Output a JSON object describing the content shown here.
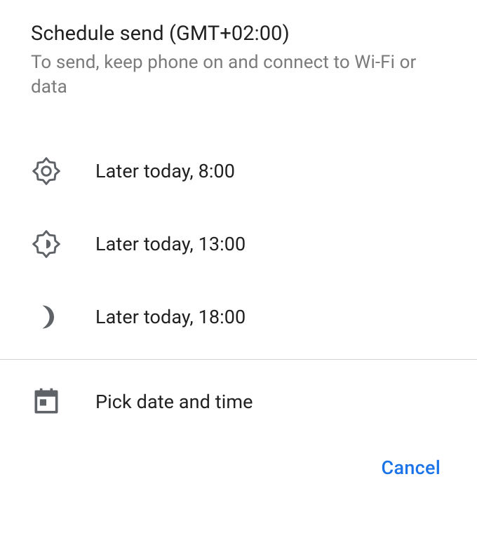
{
  "header": {
    "title": "Schedule send (GMT+02:00)",
    "subtitle": "To send, keep phone on and connect to Wi-Fi or data"
  },
  "options": [
    {
      "icon": "brightness-high-icon",
      "label": "Later today, 8:00"
    },
    {
      "icon": "brightness-medium-icon",
      "label": "Later today, 13:00"
    },
    {
      "icon": "night-icon",
      "label": "Later today, 18:00"
    }
  ],
  "custom_option": {
    "icon": "calendar-icon",
    "label": "Pick date and time"
  },
  "footer": {
    "cancel_label": "Cancel"
  }
}
